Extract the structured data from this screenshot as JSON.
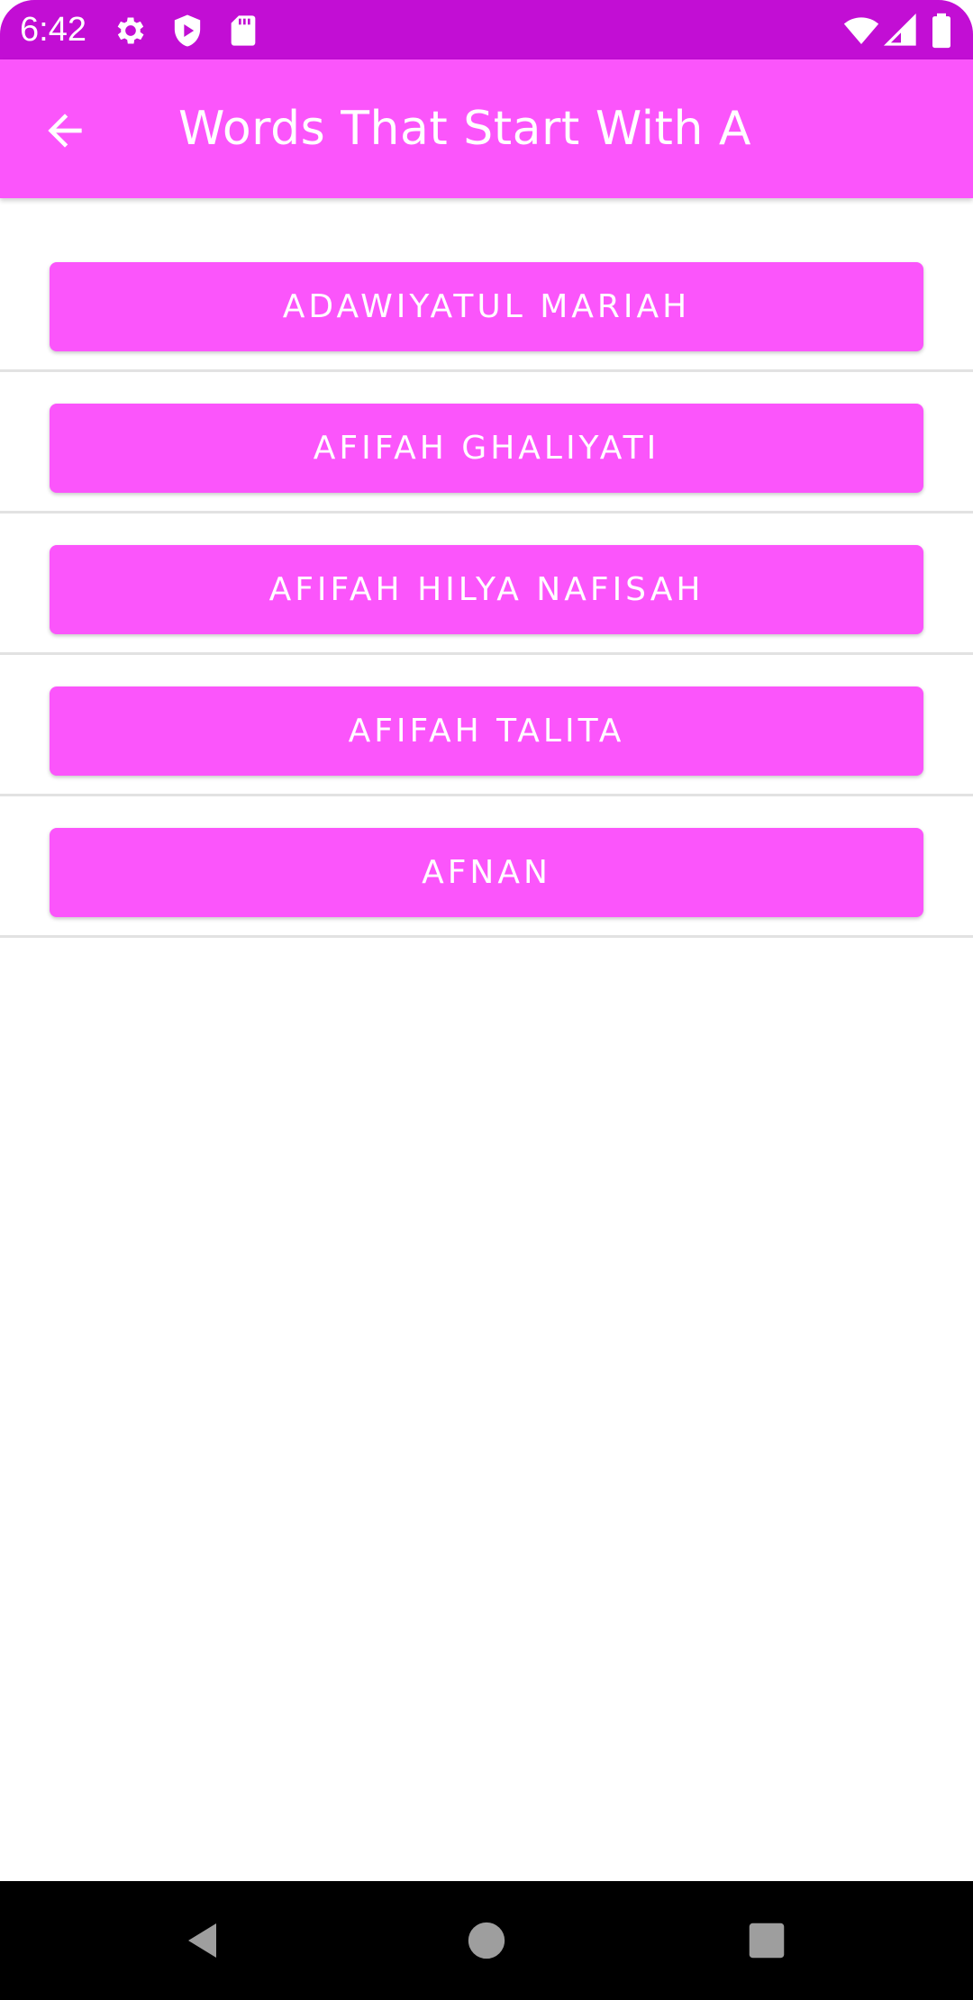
{
  "status_bar": {
    "time": "6:42",
    "left_icons": [
      "gear-icon",
      "play-shield-icon",
      "sd-card-icon"
    ],
    "right_icons": [
      "wifi-icon",
      "signal-icon",
      "battery-icon"
    ],
    "background": "#c20ed4"
  },
  "app_bar": {
    "title": "Words That Start With A",
    "back_icon": "arrow-back-icon",
    "background": "#fb55fb"
  },
  "words": [
    {
      "label": "ADAWIYATUL MARIAH"
    },
    {
      "label": "AFIFAH GHALIYATI"
    },
    {
      "label": "AFIFAH HILYA NAFISAH"
    },
    {
      "label": "AFIFAH TALITA"
    },
    {
      "label": "AFNAN"
    }
  ],
  "navigation_bar": {
    "buttons": [
      "back-triangle-icon",
      "home-circle-icon",
      "recents-square-icon"
    ]
  },
  "colors": {
    "accent": "#fb55fb",
    "status": "#c20ed4",
    "divider": "#e2e2e2"
  }
}
